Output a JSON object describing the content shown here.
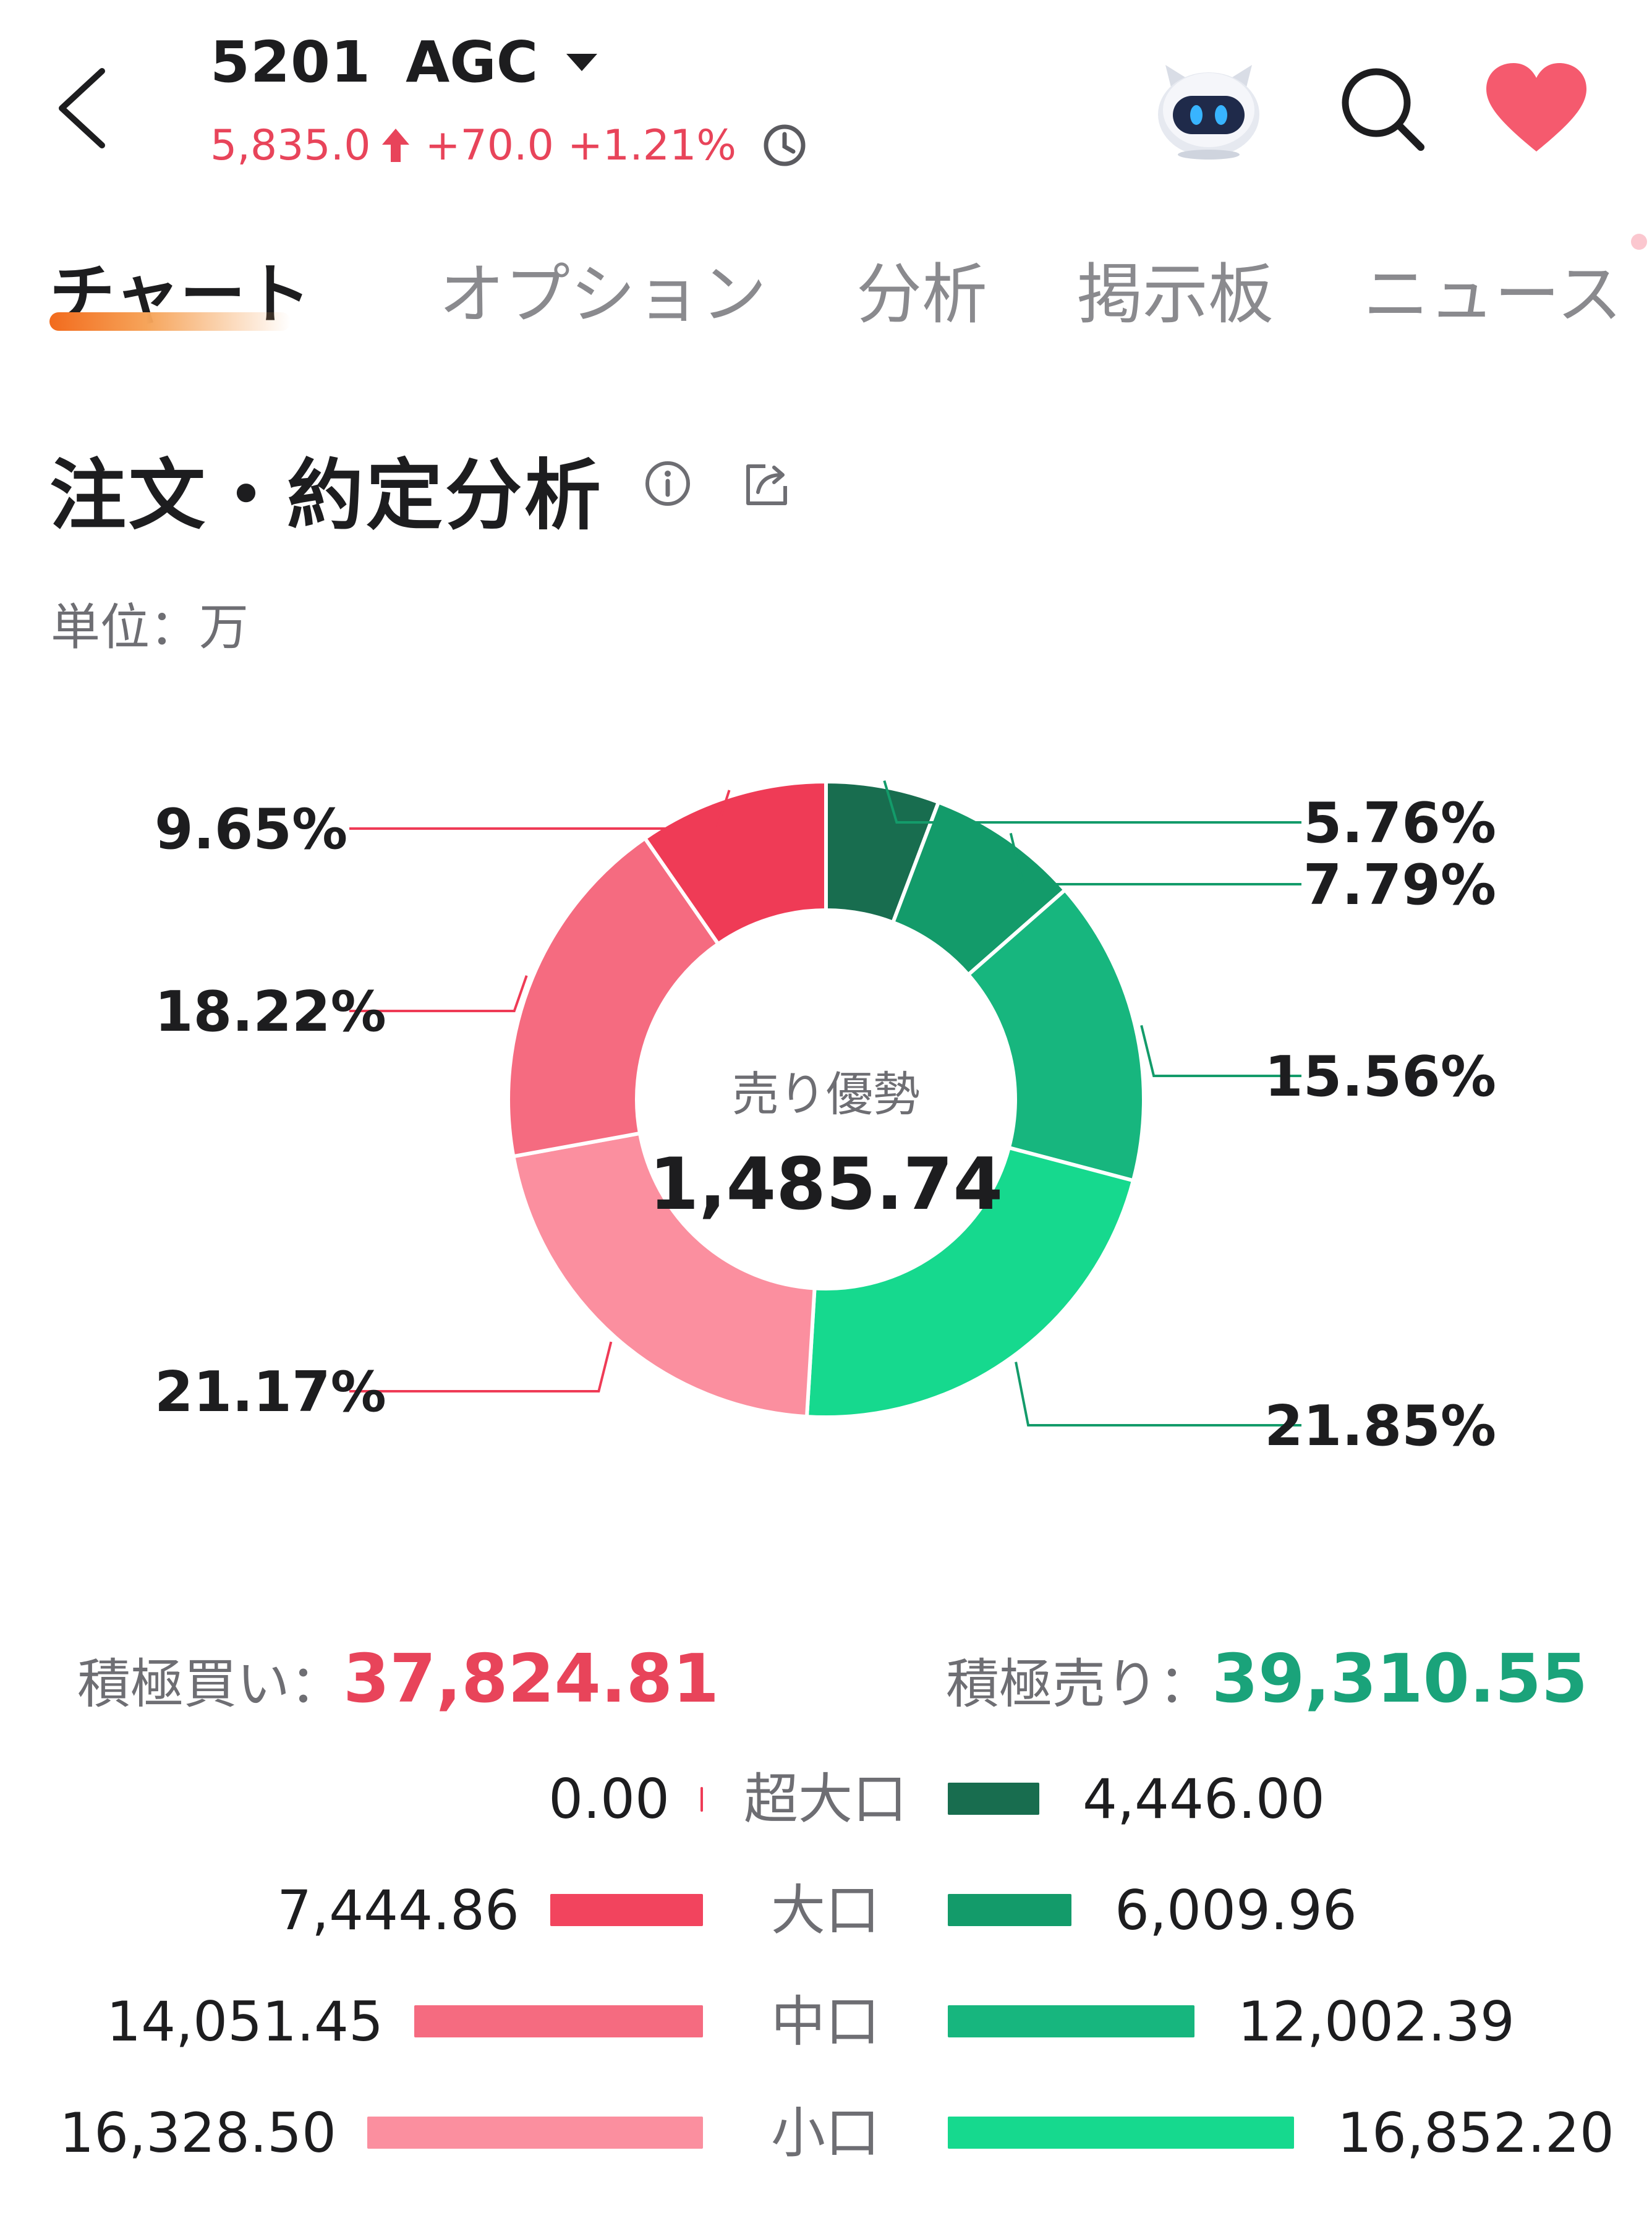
{
  "header": {
    "code": "5201",
    "name": "AGC",
    "price": "5,835.0",
    "change": "+70.0",
    "change_pct": "+1.21%"
  },
  "tabs": [
    {
      "label": "チャート",
      "active": true
    },
    {
      "label": "オプション",
      "active": false
    },
    {
      "label": "分析",
      "active": false
    },
    {
      "label": "掲示板",
      "active": false
    },
    {
      "label": "ニュース",
      "active": false
    }
  ],
  "section": {
    "title": "注文・約定分析",
    "unit": "単位：万"
  },
  "colors": {
    "up": "#e8445a",
    "sell_total": "#1aa37a",
    "buy_xl": "#ef3b56",
    "buy_l": "#f2445e",
    "buy_m": "#f56b80",
    "buy_s": "#fb8f9f",
    "sell_xl": "#186d4f",
    "sell_l": "#139b6a",
    "sell_m": "#17b67e",
    "sell_s": "#16d98e",
    "heart": "#f55a6e"
  },
  "icons": [
    "back-icon",
    "chevron-down-icon",
    "arrow-up-icon",
    "clock-icon",
    "robot-icon",
    "search-icon",
    "heart-icon",
    "info-icon",
    "share-icon"
  ],
  "chart_data": {
    "type": "pie",
    "center_label": "売り優勢",
    "center_value": "1,485.74",
    "slices": [
      {
        "label": "5.76%",
        "value": 5.76,
        "side": "sell",
        "color": "#186d4f"
      },
      {
        "label": "7.79%",
        "value": 7.79,
        "side": "sell",
        "color": "#139b6a"
      },
      {
        "label": "15.56%",
        "value": 15.56,
        "side": "sell",
        "color": "#17b67e"
      },
      {
        "label": "21.85%",
        "value": 21.85,
        "side": "sell",
        "color": "#16d98e"
      },
      {
        "label": "21.17%",
        "value": 21.17,
        "side": "buy",
        "color": "#fb8f9f"
      },
      {
        "label": "18.22%",
        "value": 18.22,
        "side": "buy",
        "color": "#f56b80"
      },
      {
        "label": "9.65%",
        "value": 9.65,
        "side": "buy",
        "color": "#ef3b56"
      }
    ]
  },
  "totals": {
    "buy_label": "積極買い：",
    "buy_value": "37,824.81",
    "sell_label": "積極売り：",
    "sell_value": "39,310.55"
  },
  "breakdown": [
    {
      "category": "超大口",
      "buy": "0.00",
      "buy_num": 0.0,
      "sell": "4,446.00",
      "sell_num": 4446.0
    },
    {
      "category": "大口",
      "buy": "7,444.86",
      "buy_num": 7444.86,
      "sell": "6,009.96",
      "sell_num": 6009.96
    },
    {
      "category": "中口",
      "buy": "14,051.45",
      "buy_num": 14051.45,
      "sell": "12,002.39",
      "sell_num": 12002.39
    },
    {
      "category": "小口",
      "buy": "16,328.50",
      "buy_num": 16328.5,
      "sell": "16,852.20",
      "sell_num": 16852.2
    }
  ]
}
